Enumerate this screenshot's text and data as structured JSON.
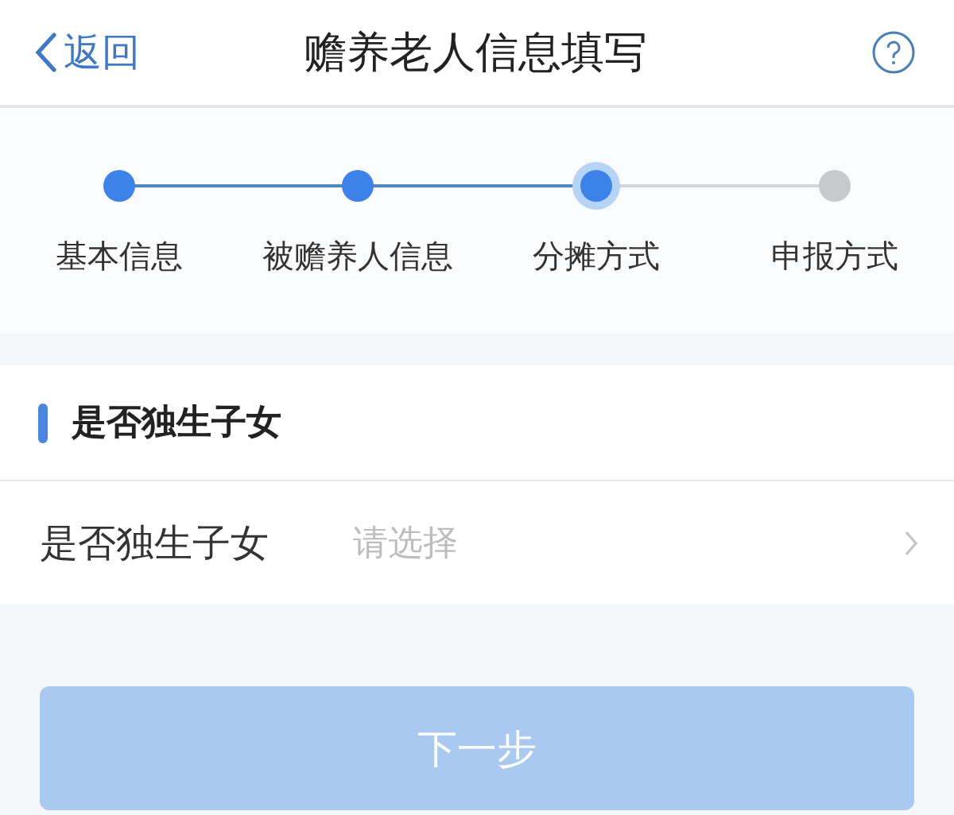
{
  "header": {
    "back": "返回",
    "title": "赡养老人信息填写"
  },
  "steps": [
    {
      "label": "基本信息",
      "completed": true,
      "selected": false
    },
    {
      "label": "被赡养人信息",
      "completed": true,
      "selected": false
    },
    {
      "label": "分摊方式",
      "completed": false,
      "selected": true
    },
    {
      "label": "申报方式",
      "completed": false,
      "selected": false
    }
  ],
  "section": {
    "title": "是否独生子女"
  },
  "field": {
    "label": "是否独生子女",
    "placeholder": "请选择"
  },
  "next_button": {
    "label": "下一步",
    "disabled": true
  }
}
